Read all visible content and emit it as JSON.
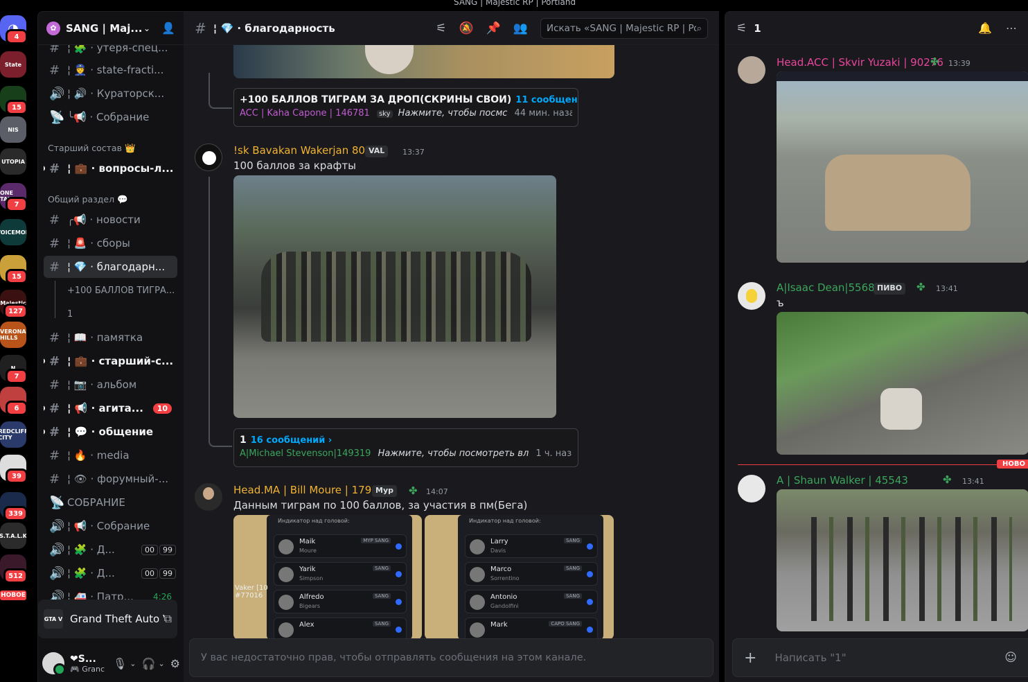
{
  "window": {
    "title": "SANG | Majestic RP | Portland"
  },
  "rail": {
    "home_badge": "4",
    "servers": [
      {
        "label": "State",
        "color": "#7a1f2b",
        "badge": ""
      },
      {
        "label": "",
        "color": "#163f1a",
        "badge": "15"
      },
      {
        "label": "NIS",
        "color": "#5b5e66",
        "badge": ""
      },
      {
        "label": "UTOPIA",
        "color": "#2a2a2a",
        "badge": ""
      },
      {
        "label": "ONE TAKE",
        "color": "#5a2a6a",
        "badge": "7"
      },
      {
        "label": "VOICEMOD",
        "color": "#0e3b3a",
        "badge": ""
      },
      {
        "label": "",
        "color": "#caa03a",
        "badge": "15"
      },
      {
        "label": "Majestic",
        "color": "#3a1010",
        "badge": "127"
      },
      {
        "label": "VERONA HILLS",
        "color": "#b8541a",
        "badge": ""
      },
      {
        "label": "N",
        "color": "#202020",
        "badge": "7"
      },
      {
        "label": "",
        "color": "#c04040",
        "badge": "6"
      },
      {
        "label": "REDCLIFF CITY",
        "color": "#2a3a6a",
        "badge": ""
      },
      {
        "label": "",
        "color": "#dddddd",
        "badge": "39"
      },
      {
        "label": "",
        "color": "#1a2a4a",
        "badge": "339"
      },
      {
        "label": "S.T.A.L.K",
        "color": "#2b2b2b",
        "badge": ""
      },
      {
        "label": "",
        "color": "#3a1a2a",
        "badge": "512"
      }
    ],
    "new_label": "НОВОЕ"
  },
  "sidebar": {
    "server_name": "SANG | Maj...",
    "channels": [
      {
        "icon": "#",
        "label": "¦ 🧩 · утеря-спец...",
        "bold": false,
        "active": false
      },
      {
        "icon": "#",
        "label": "¦ 👮 · state-fracti...",
        "bold": false,
        "active": false
      },
      {
        "icon": "🔊",
        "label": "¦ 🔊 · Кураторск...",
        "bold": false,
        "active": false
      },
      {
        "icon": "📡",
        "label": "╰📢 · Собрание",
        "bold": false,
        "active": false
      }
    ],
    "cat_senior": "Старший состав 👑",
    "senior_channels": [
      {
        "icon": "#",
        "label": "¦ 💼 · вопросы-л...",
        "bold": true
      }
    ],
    "cat_general": "Общий раздел 💬",
    "general_channels": [
      {
        "icon": "#",
        "label": "╭📢 · новости",
        "bold": false
      },
      {
        "icon": "#",
        "label": "¦ 🚨 · сборы",
        "bold": false
      },
      {
        "icon": "#",
        "label": "¦ 💎 · благодарн...",
        "bold": false,
        "active": true
      }
    ],
    "threads": [
      "+100 БАЛЛОВ ТИГРА...",
      "1"
    ],
    "more_channels": [
      {
        "icon": "#",
        "label": "¦ 📖 · памятка",
        "bold": false
      },
      {
        "icon": "#",
        "label": "¦ 💼 · старший-с...",
        "bold": true
      },
      {
        "icon": "#",
        "label": "¦ 📷 · альбом",
        "bold": false
      },
      {
        "icon": "#",
        "label": "¦ 📢 · агита...",
        "bold": true,
        "mention": "10"
      },
      {
        "icon": "#",
        "label": "¦ 💬 · общение",
        "bold": true
      },
      {
        "icon": "#",
        "label": "¦ 🔥 · media",
        "bold": false
      },
      {
        "icon": "#",
        "label": "¦ 👁 · форумный-...",
        "bold": false
      },
      {
        "icon": "📡",
        "label": "СОБРАНИЕ",
        "bold": false
      },
      {
        "icon": "🔊",
        "label": "¦ 📢 · Собрание",
        "bold": false
      },
      {
        "icon": "🔊",
        "label": "¦ 🧩 · Д...",
        "bold": false,
        "vc": [
          "00",
          "99"
        ]
      },
      {
        "icon": "🔊",
        "label": "¦ 🧩 · Д...",
        "bold": false,
        "vc": [
          "00",
          "99"
        ]
      },
      {
        "icon": "🔊",
        "label": "¦ 🚑 · Патр...",
        "bold": false,
        "time": "4:26"
      }
    ],
    "activity": {
      "game": "Grand Theft Auto V L...",
      "icon_text": "GTA V"
    },
    "user": {
      "name": "❤S...",
      "status": "🎮 Granc"
    }
  },
  "main": {
    "channel_name": "¦ 💎 · благодарность",
    "search_placeholder": "Искать «SANG | Majestic RP | Po...",
    "thread1": {
      "title": "+100 БАЛЛОВ ТИГРАМ ЗА ДРОП(СКРИНЫ СВОИ)",
      "count": "11 сообщений ›",
      "author": "ACC | Kaha Capone | 146781",
      "tag": "sky",
      "preview": "Нажмите, чтобы посмс",
      "time": "44 мин. назад"
    },
    "msg1": {
      "author": "!sk Bavakan Wakerjan 8062",
      "tag": "VAL",
      "time": "13:37",
      "text": "100 баллов за крафты"
    },
    "thread2": {
      "title": "1",
      "count": "16 сообщений ›",
      "author": "A|Michael Stevenson|149319",
      "preview": "Нажмите, чтобы посмотреть вл",
      "time": "1 ч. назад"
    },
    "msg2": {
      "author": "Head.MA | Bill Moure | 17942",
      "tag": "Myp",
      "time": "14:07",
      "text": "Данным тиграм по 100 баллов, за участия в пм(Бега)"
    },
    "rows_left": [
      {
        "first": "Maik",
        "last": "Moure",
        "chip": "MYP SANG"
      },
      {
        "first": "Yarik",
        "last": "Simpson",
        "chip": "SANG"
      },
      {
        "first": "Alfredo",
        "last": "Bigears",
        "chip": "SANG"
      },
      {
        "first": "Alex",
        "last": "",
        "chip": "SANG"
      }
    ],
    "rows_right": [
      {
        "first": "Larry",
        "last": "Davis",
        "chip": "SANG"
      },
      {
        "first": "Marco",
        "last": "Sorrentino",
        "chip": "SANG"
      },
      {
        "first": "Antonio",
        "last": "Gandolfini",
        "chip": "SANG"
      },
      {
        "first": "Mark",
        "last": "",
        "chip": "CAPO SANG"
      }
    ],
    "panel_label": "Индикатор над головой:",
    "composer_text": "У вас недостаточно прав, чтобы отправлять сообщения на этом канале."
  },
  "thread_panel": {
    "title": "1",
    "messages": [
      {
        "author": "Head.ACC | Skvir Yuzaki | 90276",
        "time": "13:39",
        "text": "",
        "tag": ""
      },
      {
        "author": "A|Isaac Dean|55689",
        "time": "13:41",
        "text": "ъ",
        "tag": "ПИВО"
      },
      {
        "author": "A | Shaun Walker | 45543",
        "time": "13:41",
        "text": "",
        "tag": ""
      }
    ],
    "new_label": "НОВО",
    "composer_placeholder": "Написать \"1\""
  }
}
